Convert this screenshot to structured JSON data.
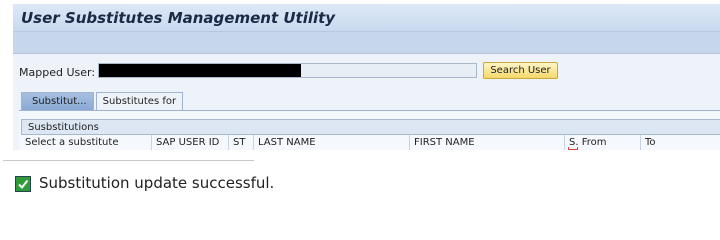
{
  "header": {
    "title": "User Substitutes Management Utility"
  },
  "mapped_user": {
    "label": "Mapped User:",
    "value": ""
  },
  "search_button": {
    "label": "Search User"
  },
  "tabs": [
    {
      "label": "Substitut...",
      "active": true
    },
    {
      "label": "Substitutes for",
      "active": false
    }
  ],
  "substitutions": {
    "group_title": "Susbstitutions",
    "columns": [
      "Select a substitute",
      "SAP USER ID",
      "ST",
      "LAST NAME",
      "FIRST NAME",
      "S. From",
      "To"
    ]
  },
  "message": {
    "icon": "success-check-icon",
    "text": "Substitution update successful."
  },
  "colors": {
    "accent": "#c9daef",
    "button": "#f6d86a",
    "success": "#2e9a3a"
  }
}
